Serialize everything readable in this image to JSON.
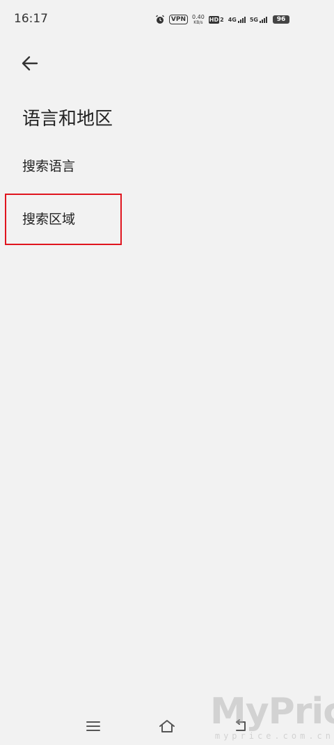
{
  "status_bar": {
    "time": "16:17",
    "vpn": "VPN",
    "speed_value": "0.40",
    "speed_unit": "KB/s",
    "hd_label": "HD",
    "hd_sub": "2",
    "net1_label": "4G",
    "net2_label": "5G",
    "battery": "96"
  },
  "header": {
    "back_icon": "arrow-left-icon"
  },
  "page": {
    "title": "语言和地区",
    "items": [
      {
        "label": "搜索语言"
      },
      {
        "label": "搜索区域"
      }
    ]
  },
  "nav_bar": {
    "icons": [
      "menu-icon",
      "home-icon",
      "back-icon"
    ]
  },
  "watermark": {
    "logo": "MyPrice",
    "sub": "myprice.com.cn"
  },
  "colors": {
    "background": "#f2f2f2",
    "highlight": "#e0141e",
    "text": "#222222"
  }
}
